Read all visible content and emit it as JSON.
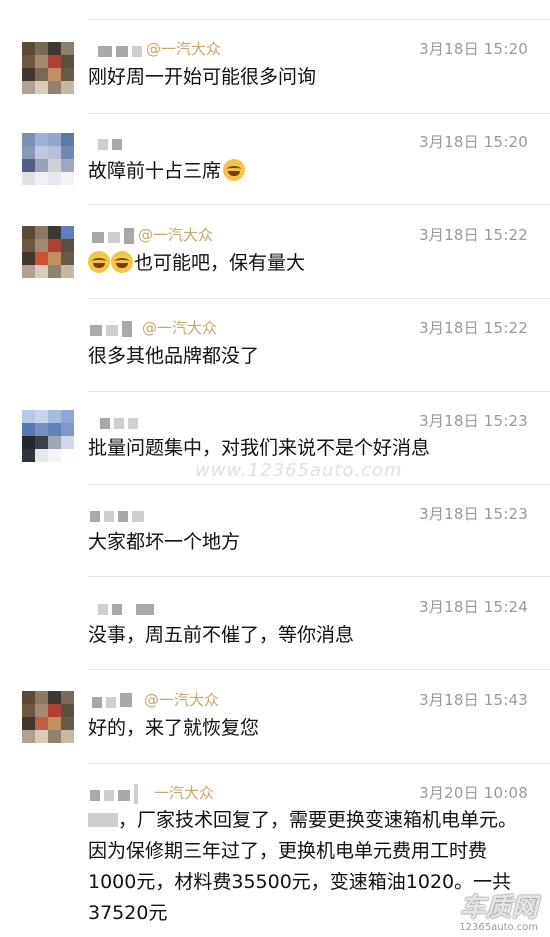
{
  "mention": "@一汽大众",
  "messages": [
    {
      "time": "3月18日 15:20",
      "text": "刚好周一开始可能很多问询",
      "mention": "@一汽大众"
    },
    {
      "time": "3月18日 15:20",
      "text": "故障前十占三席",
      "emoji": "laugh-cry-emoji"
    },
    {
      "time": "3月18日 15:22",
      "text": "也可能吧，保有量大",
      "mention": "@一汽大众",
      "emoji": "laugh-cry-emoji"
    },
    {
      "time": "3月18日 15:22",
      "text": "很多其他品牌都没了",
      "mention": "@一汽大众"
    },
    {
      "time": "3月18日 15:23",
      "text": "批量问题集中，对我们来说不是个好消息"
    },
    {
      "time": "3月18日 15:23",
      "text": "大家都坏一个地方"
    },
    {
      "time": "3月18日 15:24",
      "text": "没事，周五前不催了，等你消息"
    },
    {
      "time": "3月18日 15:43",
      "text": "好的，来了就恢复您",
      "mention": "@一汽大众"
    },
    {
      "time": "3月20日 10:08",
      "text": "，厂家技术回复了，需要更换变速箱机电单元。因为保修期三年过了，更换机电单元费用工时费1000元，材料费35500元，变速箱油1020。一共37520元",
      "mention": "一汽大众"
    }
  ],
  "watermark": "www.12365auto.com",
  "logo": {
    "big": "车质网",
    "small": "12365auto.com"
  }
}
